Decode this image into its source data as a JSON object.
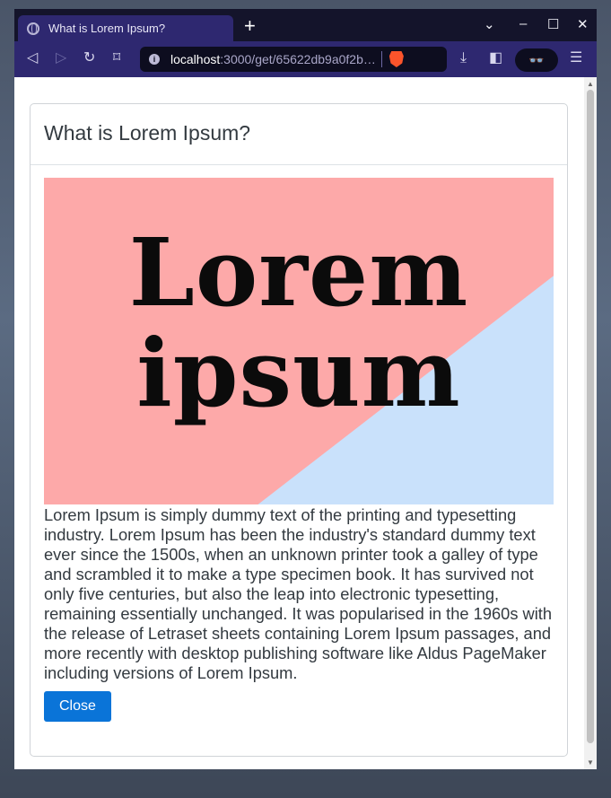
{
  "browser": {
    "tab_title": "What is Lorem Ipsum?",
    "tab_close": "×",
    "new_tab": "+",
    "url_host": "localhost",
    "url_rest": ":3000/get/65622db9a0f2b…",
    "win_dropdown": "⌄",
    "win_minimize": "–",
    "win_maximize": "☐",
    "win_close": "✕",
    "reader_label": "👓"
  },
  "modal": {
    "title": "What is Lorem Ipsum?",
    "image_text_line1": "Lorem",
    "image_text_line2": "ipsum",
    "image_colors": {
      "pink": "#fda9a9",
      "blue": "#c9e1fb"
    },
    "description": "Lorem Ipsum is simply dummy text of the printing and typesetting industry. Lorem Ipsum has been the industry's standard dummy text ever since the 1500s, when an unknown printer took a galley of type and scrambled it to make a type specimen book. It has survived not only five centuries, but also the leap into electronic typesetting, remaining essentially unchanged. It was popularised in the 1960s with the release of Letraset sheets containing Lorem Ipsum passages, and more recently with desktop publishing software like Aldus PageMaker including versions of Lorem Ipsum.",
    "close_label": "Close",
    "accent_color": "#0a74d8"
  }
}
